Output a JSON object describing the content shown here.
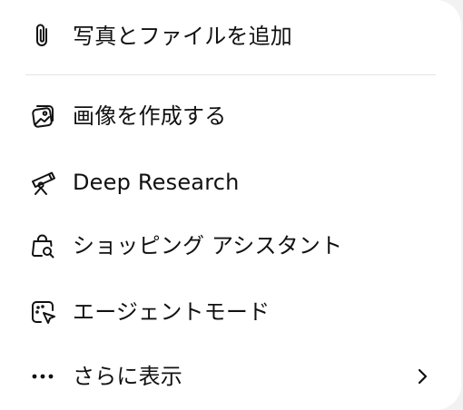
{
  "menu": {
    "items": [
      {
        "label": "写真とファイルを追加",
        "icon": "paperclip-icon"
      },
      {
        "label": "画像を作成する",
        "icon": "image-create-icon"
      },
      {
        "label": "Deep Research",
        "icon": "telescope-icon"
      },
      {
        "label": "ショッピング アシスタント",
        "icon": "shopping-bag-search-icon"
      },
      {
        "label": "エージェントモード",
        "icon": "agent-cursor-icon"
      },
      {
        "label": "さらに表示",
        "icon": "more-dots-icon"
      }
    ],
    "more_chevron": "chevron-right-icon"
  }
}
